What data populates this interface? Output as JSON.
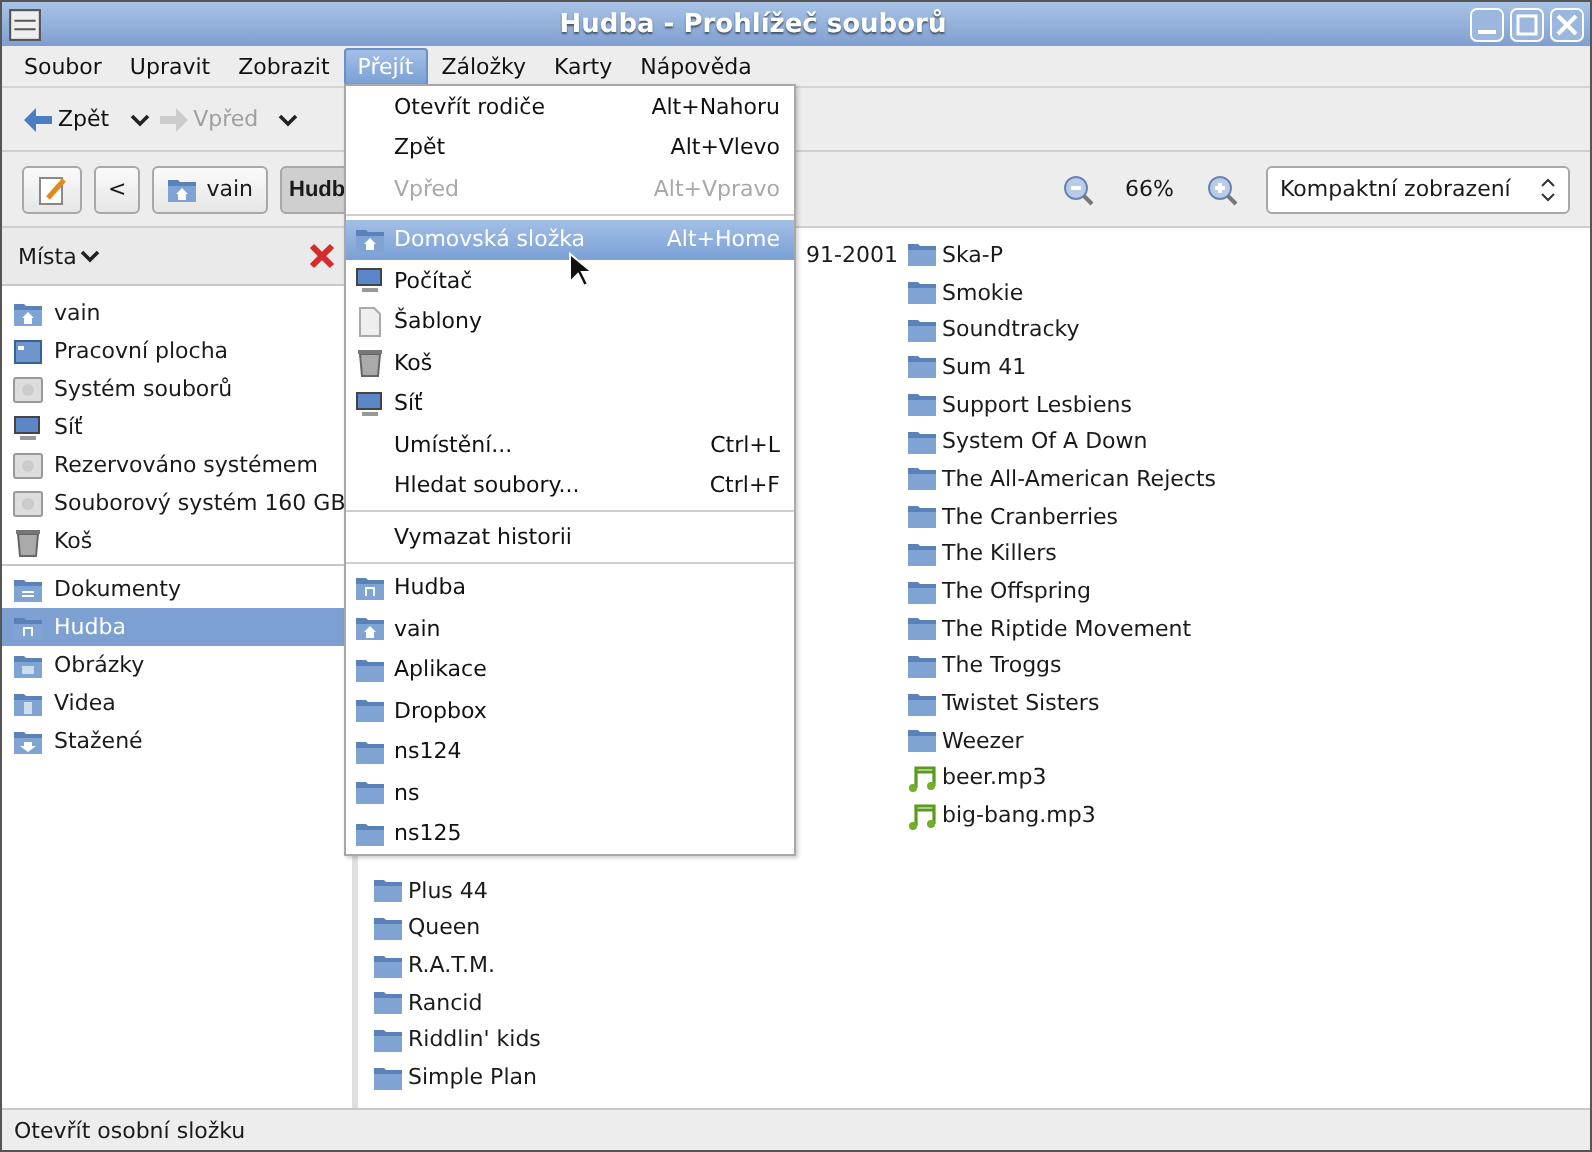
{
  "window": {
    "title": "Hudba - Prohlížeč souborů"
  },
  "menubar": [
    {
      "label": "Soubor",
      "selected": false
    },
    {
      "label": "Upravit",
      "selected": false
    },
    {
      "label": "Zobrazit",
      "selected": false
    },
    {
      "label": "Přejít",
      "selected": true
    },
    {
      "label": "Záložky",
      "selected": false
    },
    {
      "label": "Karty",
      "selected": false
    },
    {
      "label": "Nápověda",
      "selected": false
    }
  ],
  "toolbar": [
    {
      "label": "Zpět",
      "disabled": false
    },
    {
      "label": "Vpřed",
      "disabled": true
    }
  ],
  "location": {
    "back": "<",
    "crumbs": [
      {
        "label": "vain",
        "selected": false
      },
      {
        "label": "Hudb",
        "selected": true
      }
    ],
    "zoom": "66%",
    "view": "Kompaktní zobrazení"
  },
  "sidebar": {
    "title": "Místa",
    "groups": [
      [
        {
          "label": "vain",
          "kind": "home",
          "selected": false
        },
        {
          "label": "Pracovní plocha",
          "kind": "desktop",
          "selected": false
        },
        {
          "label": "Systém souborů",
          "kind": "drive",
          "selected": false
        },
        {
          "label": "Síť",
          "kind": "network",
          "selected": false
        },
        {
          "label": "Rezervováno systémem",
          "kind": "drive",
          "selected": false
        },
        {
          "label": "Souborový systém 160 GB",
          "kind": "drive",
          "selected": false
        },
        {
          "label": "Koš",
          "kind": "trash",
          "selected": false
        }
      ],
      [
        {
          "label": "Dokumenty",
          "kind": "documents",
          "selected": false
        },
        {
          "label": "Hudba",
          "kind": "music",
          "selected": true
        },
        {
          "label": "Obrázky",
          "kind": "pictures",
          "selected": false
        },
        {
          "label": "Videa",
          "kind": "video",
          "selected": false
        },
        {
          "label": "Stažené",
          "kind": "download",
          "selected": false
        }
      ]
    ]
  },
  "files": {
    "column_1": {
      "fragment": "91-2001",
      "items": [
        {
          "name": "Plus 44",
          "kind": "folder"
        },
        {
          "name": "Queen",
          "kind": "folder"
        },
        {
          "name": "R.A.T.M.",
          "kind": "folder"
        },
        {
          "name": "Rancid",
          "kind": "folder"
        },
        {
          "name": "Riddlin' kids",
          "kind": "folder"
        },
        {
          "name": "Simple Plan",
          "kind": "folder"
        }
      ]
    },
    "column_2": [
      {
        "name": "Ska-P",
        "kind": "folder"
      },
      {
        "name": "Smokie",
        "kind": "folder"
      },
      {
        "name": "Soundtracky",
        "kind": "folder"
      },
      {
        "name": "Sum 41",
        "kind": "folder"
      },
      {
        "name": "Support Lesbiens",
        "kind": "folder"
      },
      {
        "name": "System Of A Down",
        "kind": "folder"
      },
      {
        "name": "The All-American Rejects",
        "kind": "folder"
      },
      {
        "name": "The Cranberries",
        "kind": "folder"
      },
      {
        "name": "The Killers",
        "kind": "folder"
      },
      {
        "name": "The Offspring",
        "kind": "folder"
      },
      {
        "name": "The Riptide Movement",
        "kind": "folder"
      },
      {
        "name": "The Troggs",
        "kind": "folder"
      },
      {
        "name": "Twistet Sisters",
        "kind": "folder"
      },
      {
        "name": "Weezer",
        "kind": "folder"
      },
      {
        "name": "beer.mp3",
        "kind": "audio"
      },
      {
        "name": "big-bang.mp3",
        "kind": "audio"
      }
    ]
  },
  "go_menu": [
    {
      "kind": "plain",
      "label": "Otevřít rodiče",
      "shortcut": "Alt+Nahoru",
      "disabled": false,
      "selected": false
    },
    {
      "kind": "plain",
      "label": "Zpět",
      "shortcut": "Alt+Vlevo",
      "disabled": false,
      "selected": false
    },
    {
      "kind": "plain",
      "label": "Vpřed",
      "shortcut": "Alt+Vpravo",
      "disabled": true,
      "selected": false
    },
    {
      "kind": "separator"
    },
    {
      "kind": "home",
      "label": "Domovská složka",
      "shortcut": "Alt+Home",
      "disabled": false,
      "selected": true
    },
    {
      "kind": "computer",
      "label": "Počítač",
      "disabled": false,
      "selected": false
    },
    {
      "kind": "templates",
      "label": "Šablony",
      "disabled": false,
      "selected": false
    },
    {
      "kind": "trash",
      "label": "Koš",
      "disabled": false,
      "selected": false
    },
    {
      "kind": "network",
      "label": "Síť",
      "disabled": false,
      "selected": false
    },
    {
      "kind": "plain",
      "label": "Umístění...",
      "shortcut": "Ctrl+L",
      "disabled": false,
      "selected": false
    },
    {
      "kind": "plain",
      "label": "Hledat soubory...",
      "shortcut": "Ctrl+F",
      "disabled": false,
      "selected": false
    },
    {
      "kind": "separator"
    },
    {
      "kind": "plain",
      "label": "Vymazat historii",
      "disabled": false,
      "selected": false
    },
    {
      "kind": "separator"
    },
    {
      "kind": "music",
      "label": "Hudba",
      "disabled": false,
      "selected": false
    },
    {
      "kind": "home",
      "label": "vain",
      "disabled": false,
      "selected": false
    },
    {
      "kind": "folder",
      "label": "Aplikace",
      "disabled": false,
      "selected": false
    },
    {
      "kind": "folder",
      "label": "Dropbox",
      "disabled": false,
      "selected": false
    },
    {
      "kind": "folder",
      "label": "ns124",
      "disabled": false,
      "selected": false
    },
    {
      "kind": "folder",
      "label": "ns",
      "disabled": false,
      "selected": false
    },
    {
      "kind": "folder",
      "label": "ns125",
      "disabled": false,
      "selected": false
    }
  ],
  "status_bar": "Otevřít osobní složku"
}
